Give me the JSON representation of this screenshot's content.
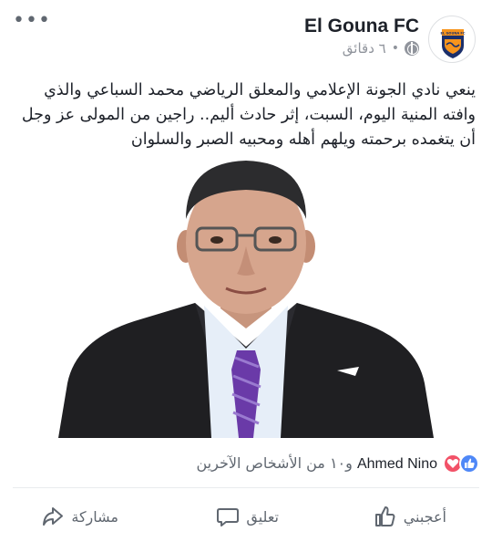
{
  "header": {
    "page_name": "El Gouna FC",
    "time": "٦ دقائق",
    "dot": "•",
    "more": "•••",
    "logo_text": "EL GOUNA FC"
  },
  "post": {
    "text": "ينعي نادي الجونة الإعلامي والمعلق الرياضي محمد السباعي والذي وافته المنية اليوم، السبت، إثر حادث أليم.. راجين من المولى عز وجل أن يتغمده برحمته ويلهم أهله ومحبيه الصبر والسلوان"
  },
  "reactions": {
    "name": "Ahmed Nino",
    "others": "و١٠ من الأشخاص الآخرين"
  },
  "actions": {
    "like": "أعجبني",
    "comment": "تعليق",
    "share": "مشاركة"
  },
  "colors": {
    "like_blue": "#4f88f7",
    "love_red": "#f25268",
    "logo_orange": "#f7941d",
    "logo_navy": "#1b2f6b"
  }
}
